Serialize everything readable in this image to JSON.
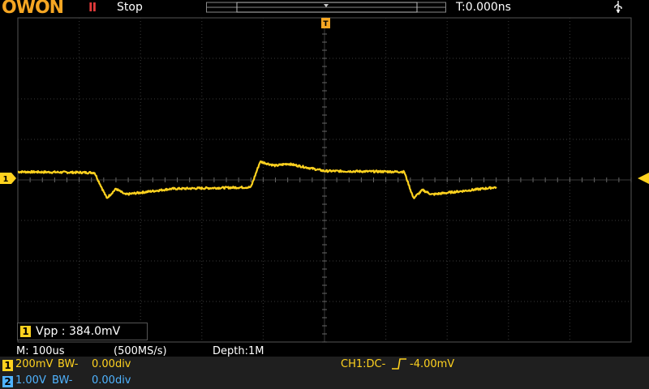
{
  "header": {
    "logo": "OWON",
    "run_icon": "II",
    "run_state": "Stop",
    "trigger_time": "T:0.000ns",
    "usb_icon": "usb-icon"
  },
  "colors": {
    "ch1": "#ffd21f",
    "ch2": "#4fb3ff",
    "trigger": "#f5a623",
    "grid": "#3a3a3a",
    "stop": "#e23b3b"
  },
  "waveform": {
    "channel": "CH1",
    "description_points": [
      [
        0,
        0.2
      ],
      [
        1.25,
        0.18
      ],
      [
        1.45,
        -0.45
      ],
      [
        1.6,
        -0.22
      ],
      [
        1.75,
        -0.36
      ],
      [
        2.5,
        -0.22
      ],
      [
        3.8,
        -0.18
      ],
      [
        3.95,
        0.45
      ],
      [
        4.2,
        0.35
      ],
      [
        4.4,
        0.4
      ],
      [
        5.0,
        0.22
      ],
      [
        6.3,
        0.2
      ],
      [
        6.45,
        -0.45
      ],
      [
        6.6,
        -0.25
      ],
      [
        6.75,
        -0.36
      ],
      [
        7.8,
        -0.18
      ]
    ]
  },
  "measurement": {
    "badge": "1",
    "text": "Vpp : 384.0mV"
  },
  "status": {
    "timebase": "M: 100us",
    "sample_rate": "(500MS/s)",
    "depth": "Depth:1M"
  },
  "channels": [
    {
      "badge": "1",
      "volts": "200mV",
      "bw": "BW-",
      "offset": "0.00div"
    },
    {
      "badge": "2",
      "volts": "1.00V",
      "bw": "BW-",
      "offset": "0.00div"
    }
  ],
  "trigger": {
    "source": "CH1:DC-",
    "level": "-4.00mV"
  }
}
